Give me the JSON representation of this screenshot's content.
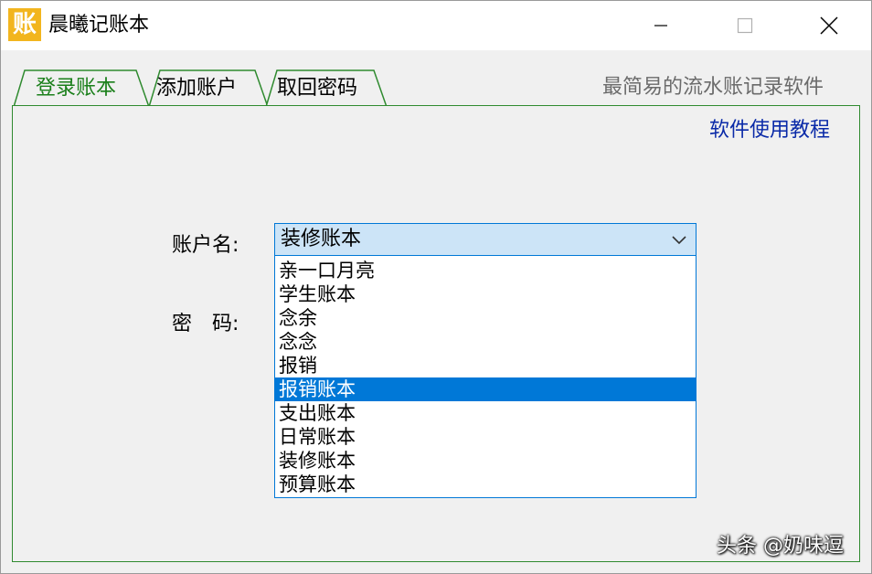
{
  "window": {
    "title": "晨曦记账本",
    "icon": "账",
    "controls": {
      "minimize": "minimize-icon",
      "maximize": "maximize-icon",
      "close": "close-icon"
    }
  },
  "tabs": [
    {
      "label": "登录账本",
      "active": true
    },
    {
      "label": "添加账户",
      "active": false
    },
    {
      "label": "取回密码",
      "active": false
    }
  ],
  "tagline": "最简易的流水账记录软件",
  "login": {
    "tutorial_link": "软件使用教程",
    "account_label": "账户名:",
    "password_label": "密　码:",
    "account_value": "装修账本",
    "options": [
      "亲一口月亮",
      "学生账本",
      "念余",
      "念念",
      "报销",
      "报销账本",
      "支出账本",
      "日常账本",
      "装修账本",
      "预算账本"
    ],
    "highlighted_option": "报销账本"
  },
  "watermark": "头条 @奶味逗",
  "colors": {
    "accent_green": "#1a7f1a",
    "link_blue": "#0a2aa8",
    "selection_blue": "#0078d7",
    "combo_bg": "#cce4f7",
    "icon_yellow": "#f2b51e"
  }
}
